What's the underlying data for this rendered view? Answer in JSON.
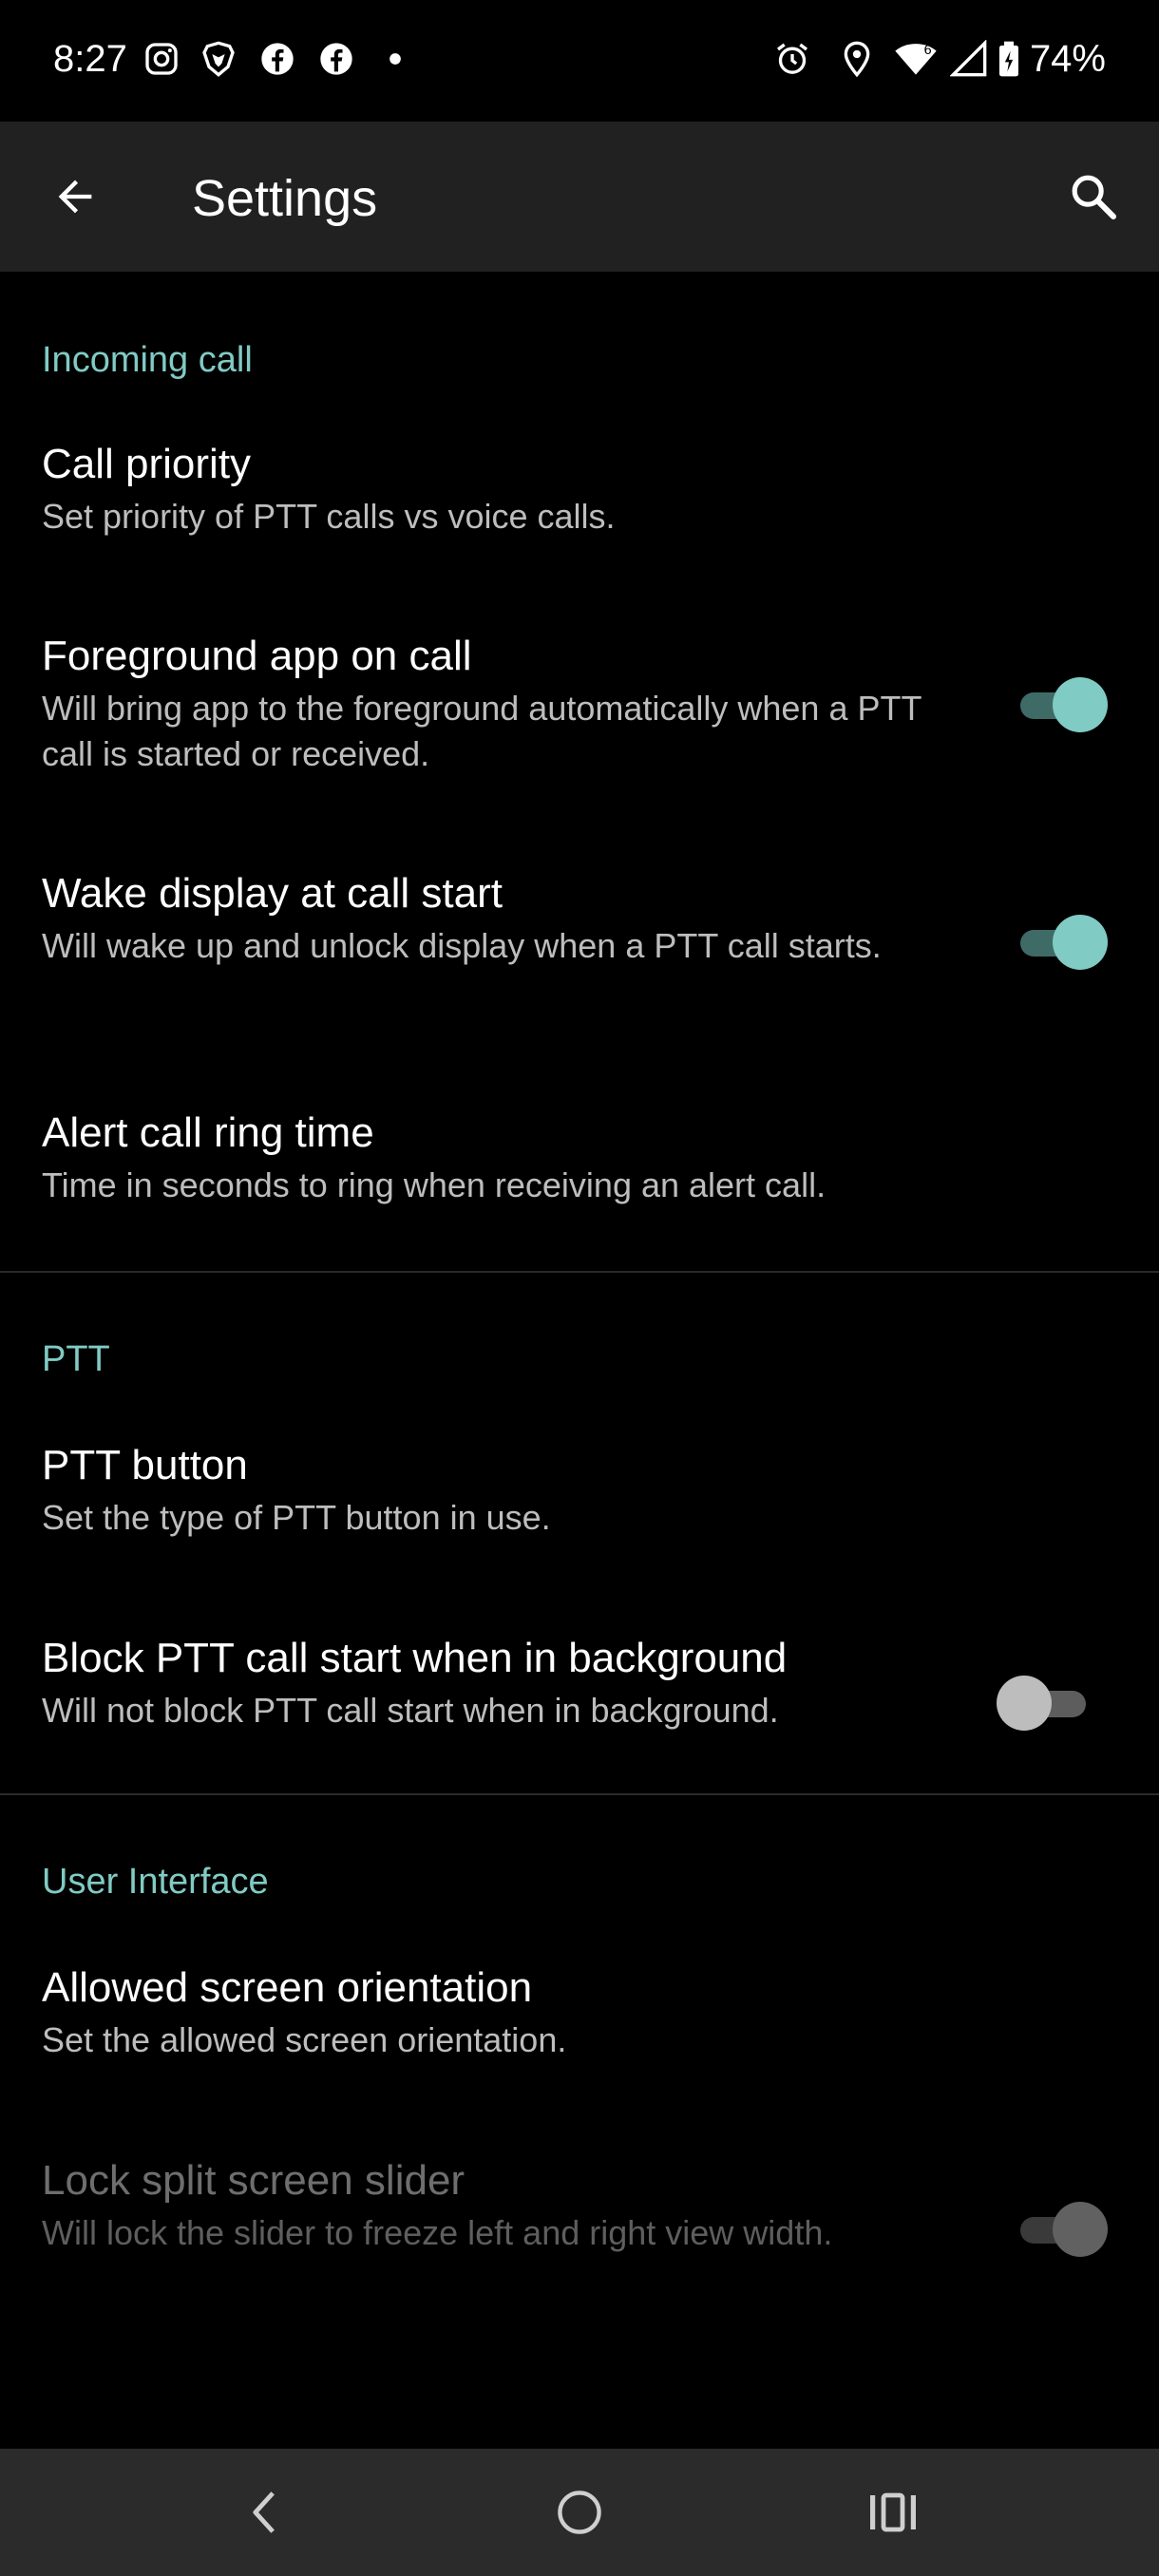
{
  "status_bar": {
    "time": "8:27",
    "battery": "74%",
    "left_icons": [
      "instagram-icon",
      "brave-icon",
      "facebook-icon",
      "facebook-icon",
      "dot-icon"
    ],
    "right_icons": [
      "alarm-icon",
      "location-icon",
      "wifi-icon",
      "signal-icon",
      "battery-icon"
    ]
  },
  "app_bar": {
    "title": "Settings",
    "back_icon": "arrow-back-icon",
    "search_icon": "search-icon"
  },
  "sections": [
    {
      "header": "Incoming call",
      "items": [
        {
          "title": "Call priority",
          "summary": "Set priority of PTT calls vs voice calls."
        },
        {
          "title": "Foreground app on call",
          "summary": "Will bring app to the foreground automatically when a PTT call is started or received.",
          "switch": "on"
        },
        {
          "title": "Wake display at call start",
          "summary": "Will wake up and unlock display when a PTT call starts.",
          "switch": "on"
        },
        {
          "title": "Alert call ring time",
          "summary": "Time in seconds to ring when receiving an alert call."
        }
      ]
    },
    {
      "header": "PTT",
      "items": [
        {
          "title": "PTT button",
          "summary": "Set the type of PTT button in use."
        },
        {
          "title": "Block PTT call start when in background",
          "summary": "Will not block PTT call start when in background.",
          "switch": "off"
        }
      ]
    },
    {
      "header": "User Interface",
      "items": [
        {
          "title": "Allowed screen orientation",
          "summary": "Set the allowed screen orientation."
        },
        {
          "title": "Lock split screen slider",
          "summary": "Will lock the slider to freeze left and right view width.",
          "switch": "on",
          "disabled": true
        }
      ]
    }
  ],
  "nav_bar": {
    "icons": [
      "nav-back-icon",
      "home-icon",
      "recents-icon"
    ]
  },
  "colors": {
    "accent": "#80cbc4",
    "app_bar": "#212121",
    "background": "#000000",
    "nav_bar": "#2b2b2b"
  }
}
